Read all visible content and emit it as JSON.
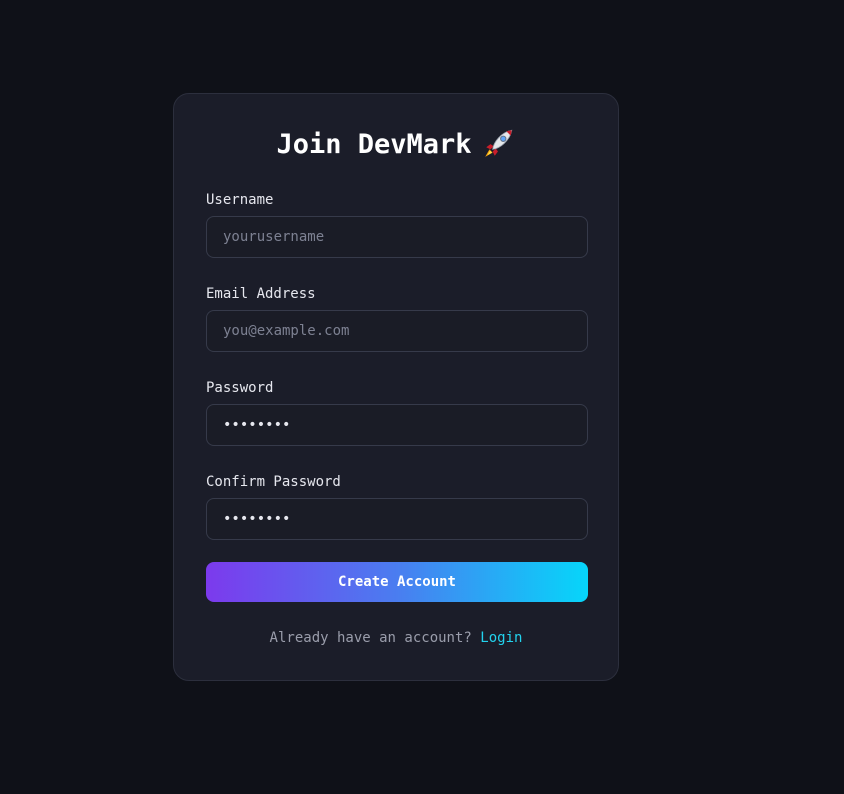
{
  "form": {
    "title": "Join DevMark",
    "title_icon": "rocket",
    "fields": {
      "username": {
        "label": "Username",
        "placeholder": "yourusername",
        "value": ""
      },
      "email": {
        "label": "Email Address",
        "placeholder": "you@example.com",
        "value": ""
      },
      "password": {
        "label": "Password",
        "value": "••••••••"
      },
      "confirm_password": {
        "label": "Confirm Password",
        "value": "••••••••"
      }
    },
    "submit_label": "Create Account",
    "footer_text": "Already have an account?",
    "login_link": "Login"
  },
  "colors": {
    "background": "#0f1118",
    "card": "#1b1d29",
    "accent_start": "#7c3aed",
    "accent_end": "#06d6fa",
    "link": "#22d3ee"
  }
}
